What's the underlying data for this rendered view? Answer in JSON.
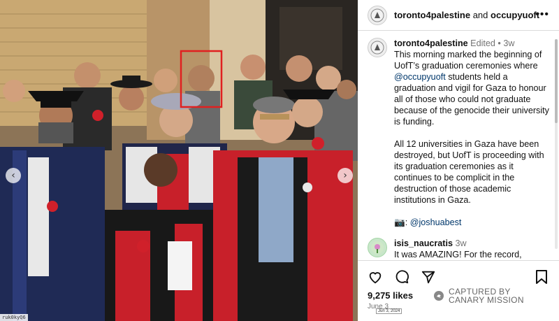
{
  "header": {
    "account": "toronto4palestine",
    "joiner": "and",
    "collaborator": "occupyuoft",
    "more_label": "•••"
  },
  "post": {
    "username": "toronto4palestine",
    "edited": "Edited",
    "dot": "•",
    "age": "3w",
    "p1_a": "This morning marked the beginning of UofT’s graduation ceremonies where ",
    "p1_mention": "@occupyuoft",
    "p1_b": " students held a graduation and vigil for Gaza to honour all of those who could not graduate because of the genocide their university is funding.",
    "p2": "All 12 universities in Gaza have been destroyed, but UofT is proceeding with its graduation ceremonies as it continues to be complicit in the destruction of those academic institutions in Gaza.",
    "credit_icon": "📷",
    "credit_sep": ":",
    "credit_handle": "@joshuabest"
  },
  "comment": {
    "username": "isis_naucratis",
    "age": "3w",
    "text": "It was AMAZING! For the record, there were so many faculty that LOADS of us who were at the back"
  },
  "footer": {
    "likes": "9,275 likes",
    "date": "June 3",
    "date_stamp": "Jun 3, 2024"
  },
  "watermark": {
    "line1": "CAPTURED BY",
    "line2": "CANARY MISSION"
  },
  "photo": {
    "nav_prev": "‹",
    "nav_next": "›",
    "handle_tag": "ruk0kyQ6"
  },
  "colors": {
    "highlight_box": "#e02020",
    "link": "#00376b",
    "muted": "#737373",
    "robe_red": "#c8202a",
    "robe_navy": "#1f2a55"
  },
  "icons": [
    "heart-icon",
    "comment-icon",
    "share-icon",
    "bookmark-icon",
    "more-icon",
    "camera-icon",
    "canary-mission-logo-icon"
  ]
}
